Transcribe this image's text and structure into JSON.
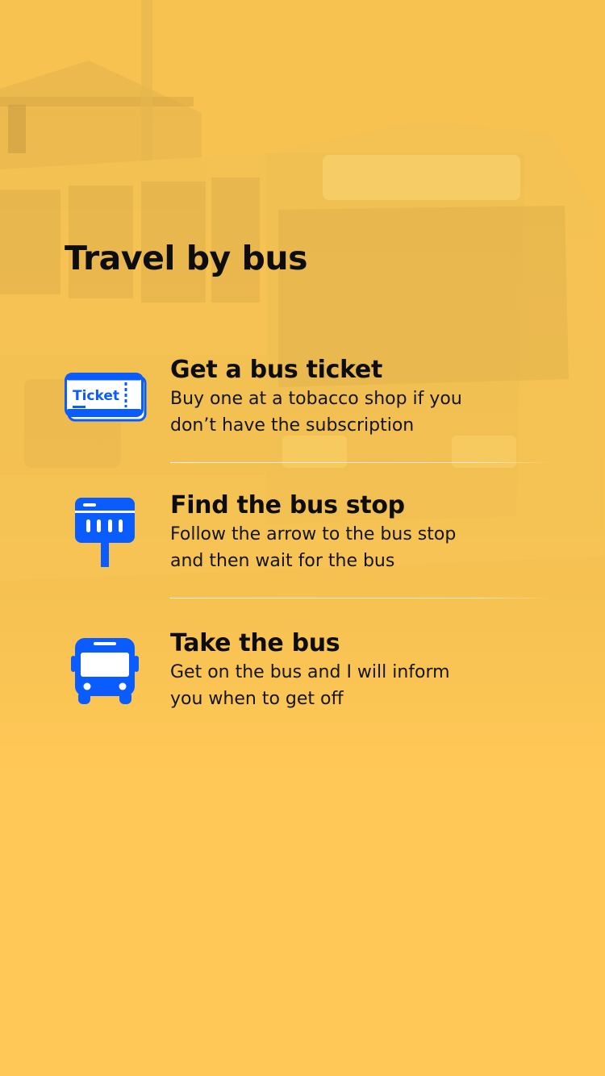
{
  "page": {
    "title": "Travel by bus"
  },
  "steps": [
    {
      "title": "Get a bus ticket",
      "description": "Buy one at a tobacco shop if you don’t have the subscription",
      "icon": "ticket-icon",
      "icon_text": "Ticket"
    },
    {
      "title": "Find the bus stop",
      "description": "Follow the arrow to the bus stop and then wait for the bus",
      "icon": "bus-stop-icon"
    },
    {
      "title": "Take the bus",
      "description": "Get on the bus and I will inform you when to get off",
      "icon": "bus-icon"
    }
  ],
  "colors": {
    "background": "#ffc857",
    "icon_blue": "#0a5cff",
    "text": "#0d0d0d",
    "divider": "#ffffff"
  }
}
